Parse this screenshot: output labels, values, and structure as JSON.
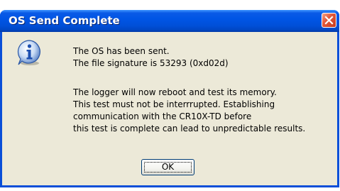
{
  "dialog": {
    "title": "OS Send Complete",
    "icon": "info-icon",
    "message_lines": [
      "The OS has been sent.",
      "The file signature is 53293 (0xd02d)",
      "",
      "The logger will now reboot and test its memory.",
      "This test must not be interrrupted.  Establishing",
      "communication with the CR10X-TD before",
      "this test is complete can lead to unpredictable results."
    ],
    "ok_label": "OK"
  },
  "colors": {
    "titlebar": "#0055e5",
    "close_button": "#e2593c",
    "dialog_face": "#ece9d8"
  }
}
